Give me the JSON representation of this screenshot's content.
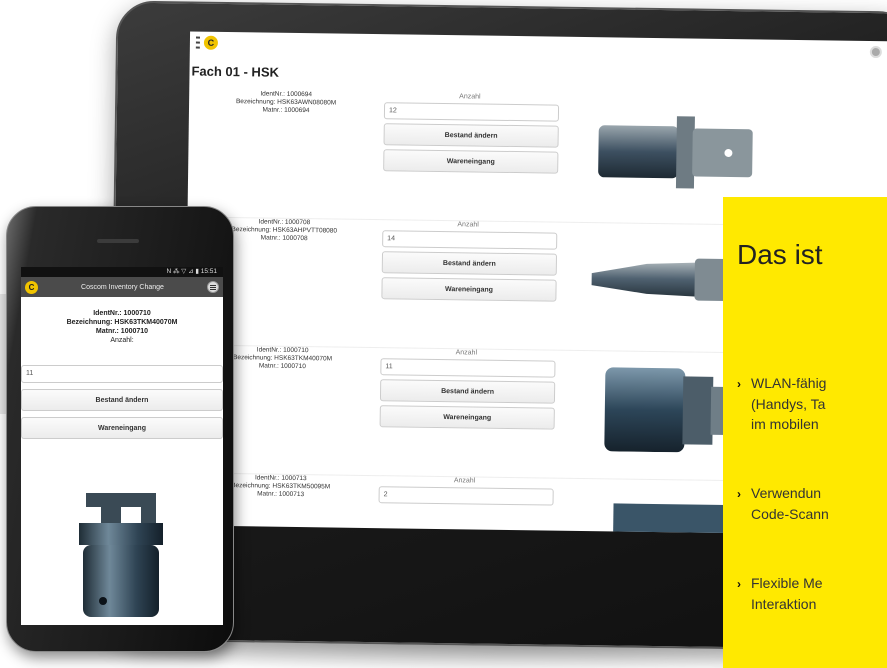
{
  "tablet": {
    "screen_title": "Fach 01 - HSK",
    "logo_letter": "C",
    "items": [
      {
        "ident": "IdentNr.: 1000694",
        "bezeichnung": "Bezeichnung: HSK63AWN08080M",
        "materialnr": "Matnr.: 1000694",
        "anzahl_label": "Anzahl",
        "anzahl_value": "12",
        "button_change": "Bestand ändern",
        "button_receipt": "Wareneingang"
      },
      {
        "ident": "IdentNr.: 1000708",
        "bezeichnung": "Bezeichnung: HSK63AHPVTT08080",
        "materialnr": "Matnr.: 1000708",
        "anzahl_label": "Anzahl",
        "anzahl_value": "14",
        "button_change": "Bestand ändern",
        "button_receipt": "Wareneingang"
      },
      {
        "ident": "IdentNr.: 1000710",
        "bezeichnung": "Bezeichnung: HSK63TKM40070M",
        "materialnr": "Matnr.: 1000710",
        "anzahl_label": "Anzahl",
        "anzahl_value": "11",
        "button_change": "Bestand ändern",
        "button_receipt": "Wareneingang"
      },
      {
        "ident": "IdentNr.: 1000713",
        "bezeichnung": "Bezeichnung: HSK63TKM50095M",
        "materialnr": "Matnr.: 1000713",
        "anzahl_label": "Anzahl",
        "anzahl_value": "2",
        "button_change": "Bestand ändern",
        "button_receipt": "Wareneingang"
      }
    ]
  },
  "phone": {
    "status_bar": "N ⁂ ▽ ⊿ ▮ 15:51",
    "app_title": "Coscom Inventory Change",
    "logo_letter": "C",
    "ident": "IdentNr.: 1000710",
    "bezeichnung": "Bezeichnung: HSK63TKM40070M",
    "materialnr": "Matnr.: 1000710",
    "anzahl_label": "Anzahl:",
    "anzahl_value": "11",
    "button_change": "Bestand ändern",
    "button_receipt": "Wareneingang"
  },
  "panel": {
    "title": "Das ist",
    "bullets": [
      {
        "line1": "WLAN-fähig",
        "line2": "(Handys, Ta",
        "line3": "im mobilen"
      },
      {
        "line1": "Verwendun",
        "line2": "Code-Scann"
      },
      {
        "line1": "Flexible Me",
        "line2": "Interaktion"
      }
    ],
    "background": "#ffe900"
  }
}
